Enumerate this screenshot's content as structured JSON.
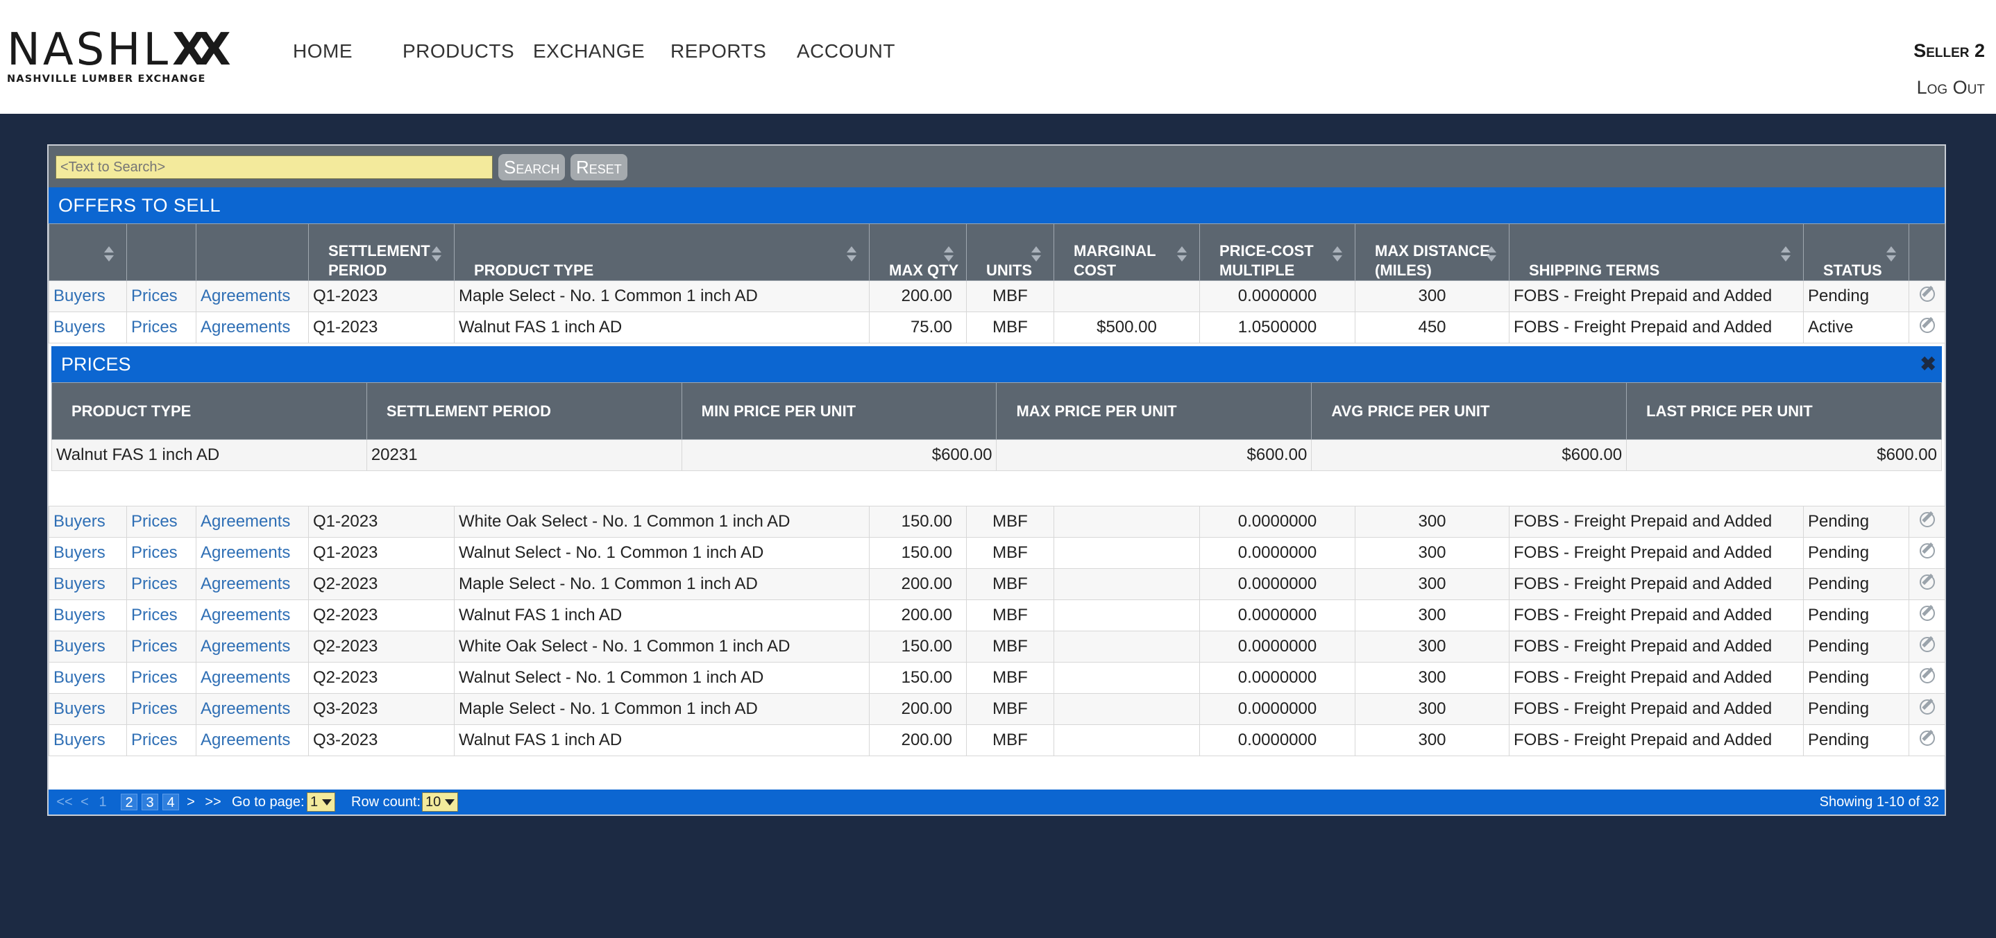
{
  "brand": {
    "logo_main": "NASHL",
    "logo_mark": "XX",
    "logo_sub": "NASHVILLE LUMBER EXCHANGE"
  },
  "nav": {
    "home": "HOME",
    "products": "PRODUCTS",
    "exchange": "EXCHANGE",
    "reports": "REPORTS",
    "account": "ACCOUNT"
  },
  "user": {
    "name": "Seller 2",
    "logout": "Log Out"
  },
  "search": {
    "placeholder": "<Text to Search>",
    "search_label": "Search",
    "reset_label": "Reset"
  },
  "offers": {
    "title": "OFFERS TO SELL",
    "headers": {
      "settlement_period": "SETTLEMENT PERIOD",
      "product_type": "PRODUCT TYPE",
      "max_qty": "MAX QTY",
      "units": "UNITS",
      "marginal_cost": "MARGINAL COST",
      "price_cost_multiple": "PRICE-COST MULTIPLE",
      "max_distance": "MAX DISTANCE (MILES)",
      "shipping_terms": "SHIPPING TERMS",
      "status": "STATUS"
    },
    "link_labels": {
      "buyers": "Buyers",
      "prices": "Prices",
      "agreements": "Agreements"
    },
    "rows_top": [
      {
        "period": "Q1-2023",
        "product": "Maple Select - No. 1 Common 1 inch AD",
        "qty": "200.00",
        "units": "MBF",
        "cost": "",
        "multiple": "0.0000000",
        "distance": "300",
        "shipping": "FOBS - Freight Prepaid and Added",
        "status": "Pending"
      },
      {
        "period": "Q1-2023",
        "product": "Walnut FAS 1 inch AD",
        "qty": "75.00",
        "units": "MBF",
        "cost": "$500.00",
        "multiple": "1.0500000",
        "distance": "450",
        "shipping": "FOBS - Freight Prepaid and Added",
        "status": "Active"
      }
    ],
    "rows_bottom": [
      {
        "period": "Q1-2023",
        "product": "White Oak Select - No. 1 Common 1 inch AD",
        "qty": "150.00",
        "units": "MBF",
        "cost": "",
        "multiple": "0.0000000",
        "distance": "300",
        "shipping": "FOBS - Freight Prepaid and Added",
        "status": "Pending"
      },
      {
        "period": "Q1-2023",
        "product": "Walnut Select - No. 1 Common 1 inch AD",
        "qty": "150.00",
        "units": "MBF",
        "cost": "",
        "multiple": "0.0000000",
        "distance": "300",
        "shipping": "FOBS - Freight Prepaid and Added",
        "status": "Pending"
      },
      {
        "period": "Q2-2023",
        "product": "Maple Select - No. 1 Common 1 inch AD",
        "qty": "200.00",
        "units": "MBF",
        "cost": "",
        "multiple": "0.0000000",
        "distance": "300",
        "shipping": "FOBS - Freight Prepaid and Added",
        "status": "Pending"
      },
      {
        "period": "Q2-2023",
        "product": "Walnut FAS 1 inch AD",
        "qty": "200.00",
        "units": "MBF",
        "cost": "",
        "multiple": "0.0000000",
        "distance": "300",
        "shipping": "FOBS - Freight Prepaid and Added",
        "status": "Pending"
      },
      {
        "period": "Q2-2023",
        "product": "White Oak Select - No. 1 Common 1 inch AD",
        "qty": "150.00",
        "units": "MBF",
        "cost": "",
        "multiple": "0.0000000",
        "distance": "300",
        "shipping": "FOBS - Freight Prepaid and Added",
        "status": "Pending"
      },
      {
        "period": "Q2-2023",
        "product": "Walnut Select - No. 1 Common 1 inch AD",
        "qty": "150.00",
        "units": "MBF",
        "cost": "",
        "multiple": "0.0000000",
        "distance": "300",
        "shipping": "FOBS - Freight Prepaid and Added",
        "status": "Pending"
      },
      {
        "period": "Q3-2023",
        "product": "Maple Select - No. 1 Common 1 inch AD",
        "qty": "200.00",
        "units": "MBF",
        "cost": "",
        "multiple": "0.0000000",
        "distance": "300",
        "shipping": "FOBS - Freight Prepaid and Added",
        "status": "Pending"
      },
      {
        "period": "Q3-2023",
        "product": "Walnut FAS 1 inch AD",
        "qty": "200.00",
        "units": "MBF",
        "cost": "",
        "multiple": "0.0000000",
        "distance": "300",
        "shipping": "FOBS - Freight Prepaid and Added",
        "status": "Pending"
      }
    ]
  },
  "prices": {
    "title": "PRICES",
    "close": "✖",
    "headers": {
      "product_type": "PRODUCT TYPE",
      "settlement_period": "SETTLEMENT PERIOD",
      "min": "MIN PRICE PER UNIT",
      "max": "MAX PRICE PER UNIT",
      "avg": "AVG PRICE PER UNIT",
      "last": "LAST PRICE PER UNIT"
    },
    "row": {
      "product": "Walnut FAS 1 inch AD",
      "period": "20231",
      "min": "$600.00",
      "max": "$600.00",
      "avg": "$600.00",
      "last": "$600.00"
    }
  },
  "pager": {
    "first": "<<",
    "prev": "<",
    "pages": [
      "1",
      "2",
      "3",
      "4"
    ],
    "next": ">",
    "last": ">>",
    "goto_label": "Go to page:",
    "goto_value": "1",
    "rowcount_label": "Row count:",
    "rowcount_value": "10",
    "showing": "Showing 1-10 of 32"
  }
}
